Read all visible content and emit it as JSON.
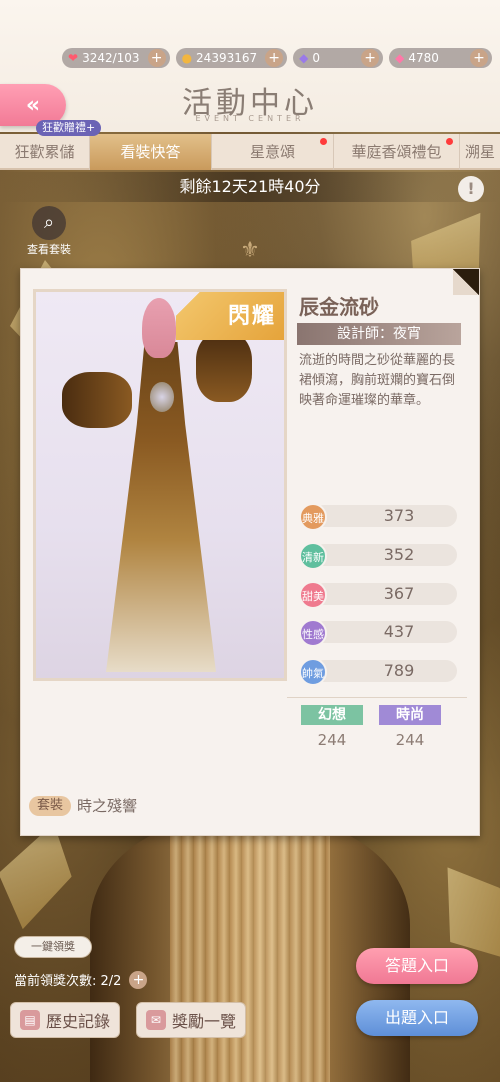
{
  "currencies": [
    {
      "icon": "heart-icon",
      "value": "3242/103"
    },
    {
      "icon": "coin-icon",
      "value": "24393167"
    },
    {
      "icon": "crystal-icon",
      "value": "0"
    },
    {
      "icon": "diamond-icon",
      "value": "4780"
    }
  ],
  "header": {
    "title": "活動中心",
    "subtitle": "EVENT CENTER",
    "gift_badge": "狂歡贈禮+"
  },
  "tabs": [
    {
      "label": "狂歡累儲",
      "active": false,
      "dot": false
    },
    {
      "label": "看裝快答",
      "active": true,
      "dot": false
    },
    {
      "label": "星意頌",
      "active": false,
      "dot": true
    },
    {
      "label": "華庭香頌禮包",
      "active": false,
      "dot": true
    },
    {
      "label": "溯星",
      "active": false,
      "dot": false
    }
  ],
  "timer": "剩餘12天21時40分",
  "view_outfit_label": "查看套裝",
  "card": {
    "shining_label": "閃耀",
    "outfit_name": "辰金流砂",
    "designer": "設計師：夜宵",
    "description": "流逝的時間之砂從華麗的長裙傾瀉，胸前斑斕的寶石倒映著命運璀璨的華章。",
    "attributes": [
      {
        "label": "典雅",
        "value": "373",
        "color": "#e39a5e"
      },
      {
        "label": "清新",
        "value": "352",
        "color": "#5fbf9e"
      },
      {
        "label": "甜美",
        "value": "367",
        "color": "#ef7a8e"
      },
      {
        "label": "性感",
        "value": "437",
        "color": "#a07ad0"
      },
      {
        "label": "帥氣",
        "value": "789",
        "color": "#6f9de0"
      }
    ],
    "categories": [
      {
        "label": "幻想",
        "value": "244",
        "color": "#7cc3a2"
      },
      {
        "label": "時尚",
        "value": "244",
        "color": "#a08ad6"
      }
    ],
    "suit_tag": "套裝",
    "suit_name": "時之殘響"
  },
  "bottom": {
    "claim_all": "一鍵領獎",
    "claim_count": "當前領獎次數: 2/2",
    "history_button": "歷史記錄",
    "rewards_button": "獎勵一覽",
    "answer_button": "答題入口",
    "quiz_button": "出題入口"
  }
}
